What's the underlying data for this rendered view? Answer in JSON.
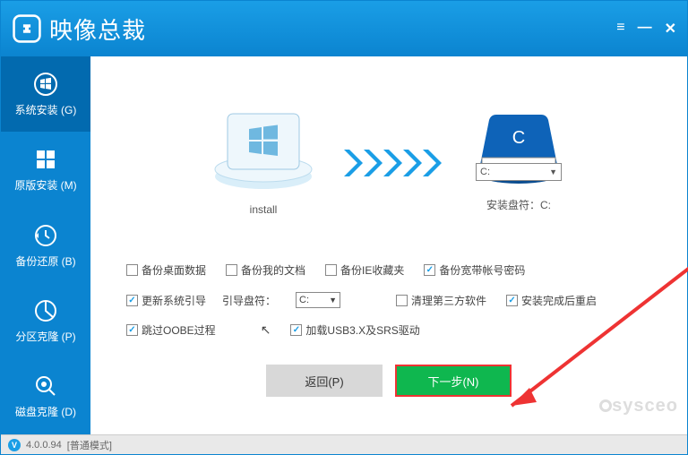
{
  "titlebar": {
    "app_title": "映像总裁"
  },
  "sidebar": {
    "items": [
      {
        "label": "系统安装 (G)"
      },
      {
        "label": "原版安装 (M)"
      },
      {
        "label": "备份还原 (B)"
      },
      {
        "label": "分区克隆 (P)"
      },
      {
        "label": "磁盘克隆 (D)"
      }
    ]
  },
  "visual": {
    "source_caption": "install",
    "target_drive_letter": "C",
    "target_select_value": "C:",
    "target_caption": "安装盘符：C:"
  },
  "options": {
    "row1": [
      {
        "label": "备份桌面数据",
        "checked": false
      },
      {
        "label": "备份我的文档",
        "checked": false
      },
      {
        "label": "备份IE收藏夹",
        "checked": false
      },
      {
        "label": "备份宽带帐号密码",
        "checked": true
      }
    ],
    "row2_first": {
      "label": "更新系统引导",
      "checked": true
    },
    "row2_select_label": "引导盘符：",
    "row2_select_value": "C:",
    "row2_rest": [
      {
        "label": "清理第三方软件",
        "checked": false
      },
      {
        "label": "安装完成后重启",
        "checked": true
      }
    ],
    "row3": [
      {
        "label": "跳过OOBE过程",
        "checked": true
      },
      {
        "label": "加载USB3.X及SRS驱动",
        "checked": true
      }
    ]
  },
  "buttons": {
    "back": "返回(P)",
    "next": "下一步(N)"
  },
  "status": {
    "version": "4.0.0.94",
    "mode": "[普通模式]"
  },
  "watermark": "sysceo"
}
